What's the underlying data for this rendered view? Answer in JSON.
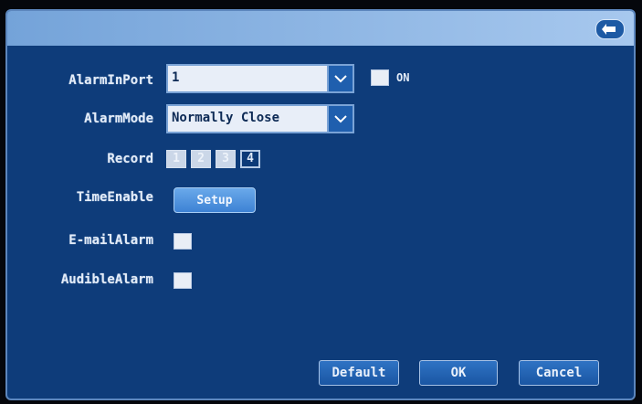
{
  "titlebar": {
    "back_icon": "back-arrow-icon"
  },
  "alarm_in_port": {
    "label": "AlarmInPort",
    "value": "1",
    "on_label": "ON"
  },
  "alarm_mode": {
    "label": "AlarmMode",
    "value": "Normally Close"
  },
  "record": {
    "label": "Record",
    "channels": [
      "1",
      "2",
      "3",
      "4"
    ],
    "selected": "4"
  },
  "time_enable": {
    "label": "TimeEnable",
    "button": "Setup"
  },
  "email_alarm": {
    "label": "E-mailAlarm"
  },
  "audible_alarm": {
    "label": "AudibleAlarm"
  },
  "footer": {
    "default_label": "Default",
    "ok_label": "OK",
    "cancel_label": "Cancel"
  },
  "colors": {
    "panel": "#0e3c7a",
    "titlebar": "#8db7e6",
    "button": "#1a56a3"
  }
}
